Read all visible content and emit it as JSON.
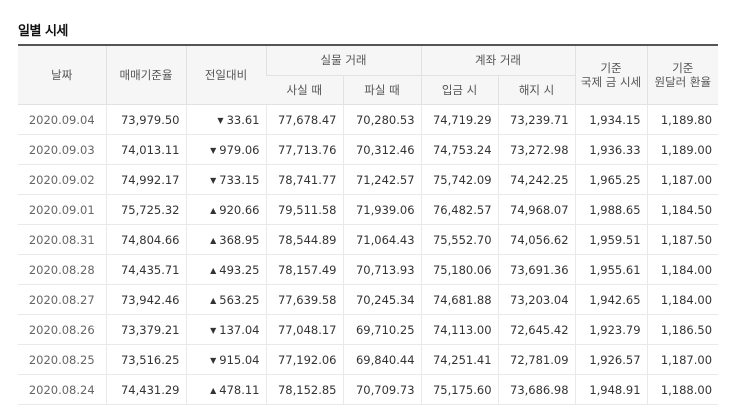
{
  "title": "일별 시세",
  "headers": {
    "date": "날짜",
    "base_rate": "매매기준율",
    "change": "전일대비",
    "cash_group": "실물 거래",
    "cash_buy": "사실 때",
    "cash_sell": "파실 때",
    "transfer_group": "계좌 거래",
    "transfer_send": "입금 시",
    "transfer_receive": "해지 시",
    "intl_gold_line1": "기준",
    "intl_gold_line2": "국제 금 시세",
    "won_dollar_line1": "기준",
    "won_dollar_line2": "원달러 환율"
  },
  "colors": {
    "up": "#c32e2e",
    "down": "#1a3a9c"
  },
  "rows": [
    {
      "date": "2020.09.04",
      "base": "73,979.50",
      "dir": "down",
      "arrow": "▼",
      "change": "33.61",
      "cash_buy": "77,678.47",
      "cash_sell": "70,280.53",
      "send": "74,719.29",
      "receive": "73,239.71",
      "gold": "1,934.15",
      "usd": "1,189.80"
    },
    {
      "date": "2020.09.03",
      "base": "74,013.11",
      "dir": "down",
      "arrow": "▼",
      "change": "979.06",
      "cash_buy": "77,713.76",
      "cash_sell": "70,312.46",
      "send": "74,753.24",
      "receive": "73,272.98",
      "gold": "1,936.33",
      "usd": "1,189.00"
    },
    {
      "date": "2020.09.02",
      "base": "74,992.17",
      "dir": "down",
      "arrow": "▼",
      "change": "733.15",
      "cash_buy": "78,741.77",
      "cash_sell": "71,242.57",
      "send": "75,742.09",
      "receive": "74,242.25",
      "gold": "1,965.25",
      "usd": "1,187.00"
    },
    {
      "date": "2020.09.01",
      "base": "75,725.32",
      "dir": "up",
      "arrow": "▲",
      "change": "920.66",
      "cash_buy": "79,511.58",
      "cash_sell": "71,939.06",
      "send": "76,482.57",
      "receive": "74,968.07",
      "gold": "1,988.65",
      "usd": "1,184.50"
    },
    {
      "date": "2020.08.31",
      "base": "74,804.66",
      "dir": "up",
      "arrow": "▲",
      "change": "368.95",
      "cash_buy": "78,544.89",
      "cash_sell": "71,064.43",
      "send": "75,552.70",
      "receive": "74,056.62",
      "gold": "1,959.51",
      "usd": "1,187.50"
    },
    {
      "date": "2020.08.28",
      "base": "74,435.71",
      "dir": "up",
      "arrow": "▲",
      "change": "493.25",
      "cash_buy": "78,157.49",
      "cash_sell": "70,713.93",
      "send": "75,180.06",
      "receive": "73,691.36",
      "gold": "1,955.61",
      "usd": "1,184.00"
    },
    {
      "date": "2020.08.27",
      "base": "73,942.46",
      "dir": "up",
      "arrow": "▲",
      "change": "563.25",
      "cash_buy": "77,639.58",
      "cash_sell": "70,245.34",
      "send": "74,681.88",
      "receive": "73,203.04",
      "gold": "1,942.65",
      "usd": "1,184.00"
    },
    {
      "date": "2020.08.26",
      "base": "73,379.21",
      "dir": "down",
      "arrow": "▼",
      "change": "137.04",
      "cash_buy": "77,048.17",
      "cash_sell": "69,710.25",
      "send": "74,113.00",
      "receive": "72,645.42",
      "gold": "1,923.79",
      "usd": "1,186.50"
    },
    {
      "date": "2020.08.25",
      "base": "73,516.25",
      "dir": "down",
      "arrow": "▼",
      "change": "915.04",
      "cash_buy": "77,192.06",
      "cash_sell": "69,840.44",
      "send": "74,251.41",
      "receive": "72,781.09",
      "gold": "1,926.57",
      "usd": "1,187.00"
    },
    {
      "date": "2020.08.24",
      "base": "74,431.29",
      "dir": "up",
      "arrow": "▲",
      "change": "478.11",
      "cash_buy": "78,152.85",
      "cash_sell": "70,709.73",
      "send": "75,175.60",
      "receive": "73,686.98",
      "gold": "1,948.91",
      "usd": "1,188.00"
    }
  ]
}
